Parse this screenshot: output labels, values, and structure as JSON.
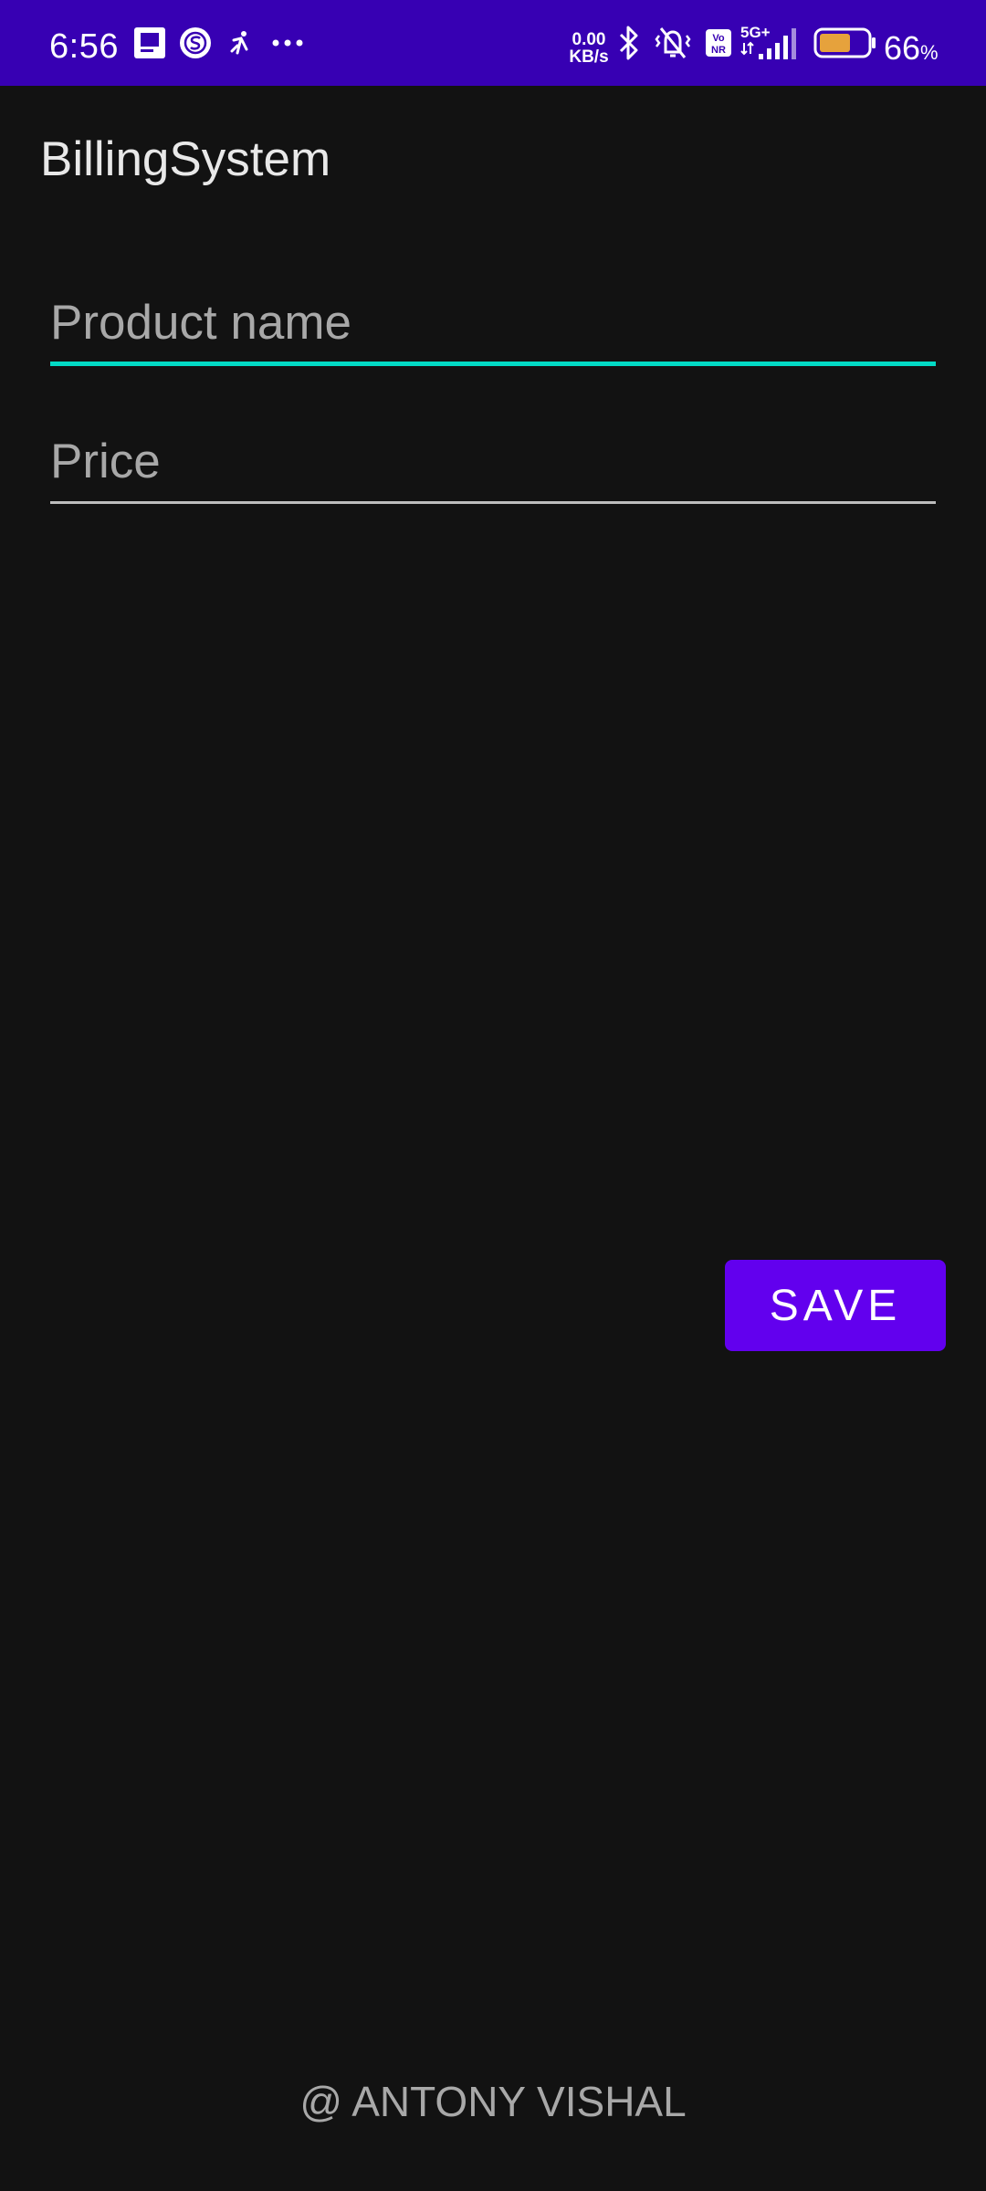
{
  "status_bar": {
    "time": "6:56",
    "net_speed_value": "0.00",
    "net_speed_unit": "KB/s",
    "network_label": "5G+",
    "volte_label": "Vo NR",
    "battery_percent": "66",
    "battery_unit": "%",
    "battery_level": 0.66,
    "icons": [
      "notes-icon",
      "s-app-icon",
      "activity-icon",
      "more-dots-icon",
      "bluetooth-icon",
      "vibrate-silent-icon",
      "vonr-icon",
      "signal-icon",
      "battery-icon"
    ]
  },
  "app_bar": {
    "title": "BillingSystem"
  },
  "form": {
    "product_name": {
      "value": "",
      "placeholder": "Product name"
    },
    "price": {
      "value": "",
      "placeholder": "Price"
    },
    "save_label": "SAVE"
  },
  "footer": {
    "credit": "@ ANTONY VISHAL"
  },
  "colors": {
    "status_bar": "#3700B3",
    "background": "#121212",
    "accent": "#03DAC5",
    "button": "#6200EE",
    "battery_fill": "#E6A23C"
  }
}
